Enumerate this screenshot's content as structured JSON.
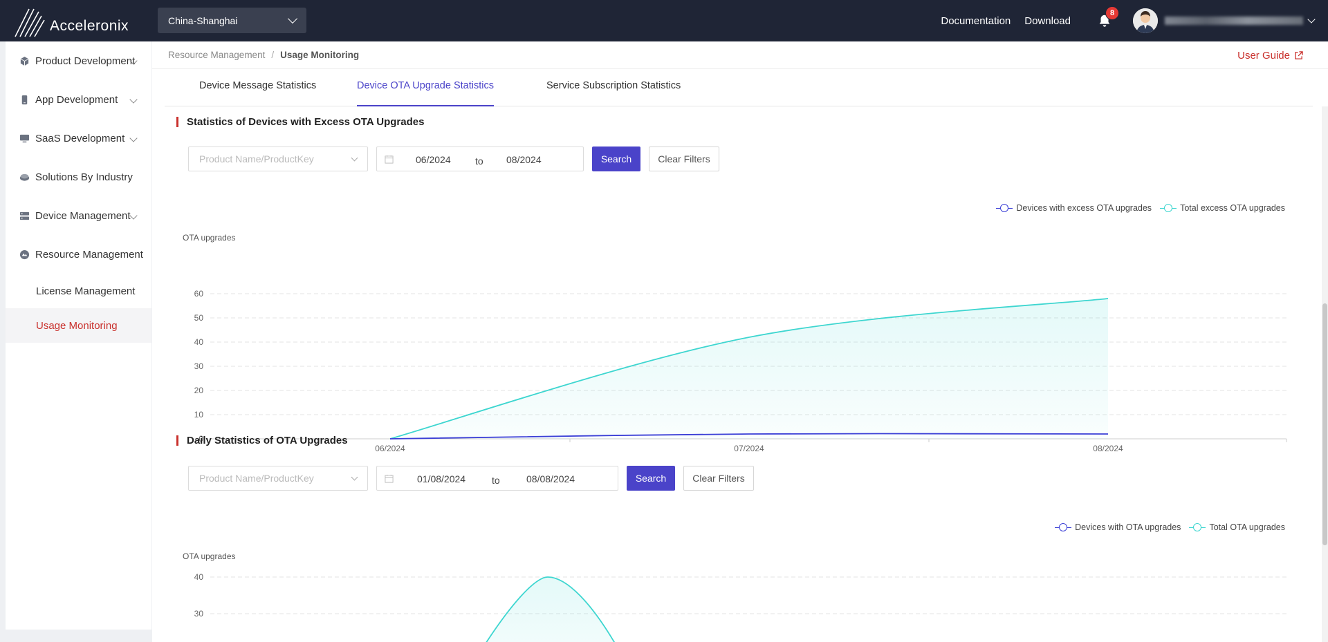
{
  "header": {
    "brand": "Acceleronix",
    "region": "China-Shanghai",
    "links": [
      "Documentation",
      "Download"
    ],
    "notification_count": "8"
  },
  "sidebar": {
    "items": [
      {
        "label": "Product Development",
        "icon": "cube-icon",
        "expandable": true
      },
      {
        "label": "App Development",
        "icon": "phone-icon",
        "expandable": true
      },
      {
        "label": "SaaS Development",
        "icon": "monitor-icon",
        "expandable": true
      },
      {
        "label": "Solutions By Industry",
        "icon": "layers-icon",
        "expandable": false
      },
      {
        "label": "Device Management",
        "icon": "server-icon",
        "expandable": true
      },
      {
        "label": "Resource Management",
        "icon": "resource-icon",
        "expandable": false
      }
    ],
    "subitems": [
      {
        "label": "License Management",
        "active": false
      },
      {
        "label": "Usage Monitoring",
        "active": true
      }
    ]
  },
  "breadcrumb": {
    "parent": "Resource Management",
    "separator": "/",
    "current": "Usage Monitoring"
  },
  "user_guide": "User Guide",
  "tabs": [
    {
      "label": "Device Message Statistics",
      "active": false
    },
    {
      "label": "Device OTA Upgrade Statistics",
      "active": true
    },
    {
      "label": "Service Subscription Statistics",
      "active": false
    }
  ],
  "section1": {
    "title": "Statistics of Devices with Excess OTA Upgrades",
    "product_placeholder": "Product Name/ProductKey",
    "date_from": "06/2024",
    "date_to_label": "to",
    "date_to": "08/2024",
    "search_label": "Search",
    "clear_label": "Clear Filters"
  },
  "section2": {
    "title": "Daily Statistics of OTA Upgrades",
    "product_placeholder": "Product Name/ProductKey",
    "date_from": "01/08/2024",
    "date_to_label": "to",
    "date_to": "08/08/2024",
    "search_label": "Search",
    "clear_label": "Clear Filters"
  },
  "colors": {
    "accent": "#4a43c9",
    "brand_red": "#c9302c",
    "series_devices": "#3b3fd6",
    "series_total": "#3ed6d0"
  },
  "chart_data": [
    {
      "type": "area",
      "ylabel": "OTA upgrades",
      "categories": [
        "06/2024",
        "07/2024",
        "08/2024"
      ],
      "ylim": [
        0,
        60
      ],
      "yticks": [
        0,
        10,
        20,
        30,
        40,
        50,
        60
      ],
      "grid": true,
      "legend_position": "top-right",
      "series": [
        {
          "name": "Devices with excess OTA upgrades",
          "values": [
            0,
            2,
            2
          ]
        },
        {
          "name": "Total excess OTA upgrades",
          "values": [
            0,
            42,
            58
          ]
        }
      ]
    },
    {
      "type": "area",
      "ylabel": "OTA upgrades",
      "ylim": [
        0,
        40
      ],
      "yticks": [
        30,
        40
      ],
      "grid": true,
      "legend_position": "top-right",
      "series": [
        {
          "name": "Devices with OTA upgrades"
        },
        {
          "name": "Total OTA upgrades",
          "peak": 40
        }
      ]
    }
  ]
}
